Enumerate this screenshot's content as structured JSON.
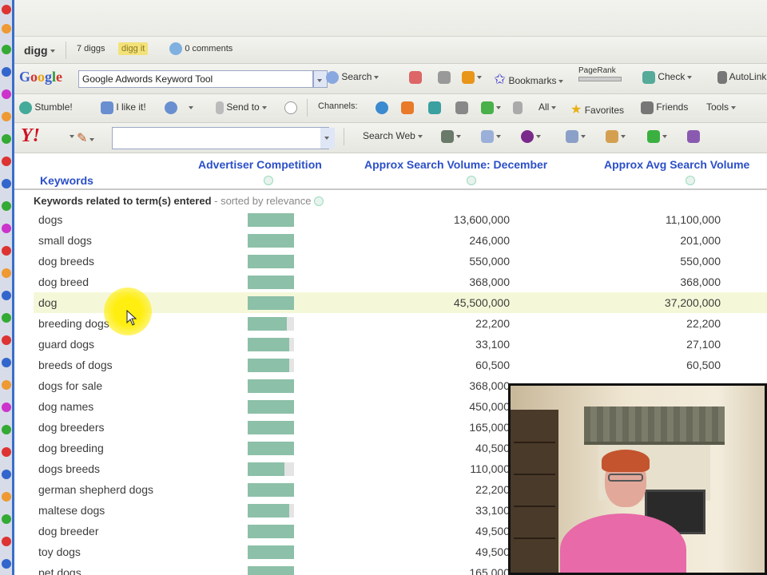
{
  "digg_toolbar": {
    "brand": "digg",
    "diggs": "7 diggs",
    "digg_button": "digg it",
    "comments": "0 comments"
  },
  "google_toolbar": {
    "logo": "Google",
    "search_value": "Google Adwords Keyword Tool",
    "search_label": "Search",
    "bookmarks_label": "Bookmarks",
    "pagerank_label": "PageRank",
    "check_label": "Check",
    "autolink_label": "AutoLink"
  },
  "stumble_toolbar": {
    "stumble_label": "Stumble!",
    "like_label": "I like it!",
    "sendto_label": "Send to",
    "channels_label": "Channels:",
    "all_label": "All",
    "favorites_label": "Favorites",
    "friends_label": "Friends",
    "tools_label": "Tools"
  },
  "yahoo_toolbar": {
    "logo": "Y!",
    "search_value": "",
    "search_web_label": "Search Web"
  },
  "table": {
    "col_keywords": "Keywords",
    "col_competition": "Advertiser Competition",
    "col_volume_december": "Approx Search Volume: December",
    "col_avg_volume": "Approx Avg Search Volume",
    "section_title": "Keywords related to term(s) entered",
    "section_sort": " - sorted by relevance",
    "rows": [
      {
        "keyword": "dogs",
        "competition": 1.0,
        "volume_december": "13,600,000",
        "avg_volume": "11,100,000"
      },
      {
        "keyword": "small dogs",
        "competition": 1.0,
        "volume_december": "246,000",
        "avg_volume": "201,000"
      },
      {
        "keyword": "dog breeds",
        "competition": 1.0,
        "volume_december": "550,000",
        "avg_volume": "550,000"
      },
      {
        "keyword": "dog breed",
        "competition": 1.0,
        "volume_december": "368,000",
        "avg_volume": "368,000"
      },
      {
        "keyword": "dog",
        "competition": 1.0,
        "volume_december": "45,500,000",
        "avg_volume": "37,200,000",
        "highlighted": true
      },
      {
        "keyword": "breeding dogs",
        "competition": 0.85,
        "volume_december": "22,200",
        "avg_volume": "22,200"
      },
      {
        "keyword": "guard dogs",
        "competition": 0.9,
        "volume_december": "33,100",
        "avg_volume": "27,100"
      },
      {
        "keyword": "breeds of dogs",
        "competition": 0.9,
        "volume_december": "60,500",
        "avg_volume": "60,500"
      },
      {
        "keyword": "dogs for sale",
        "competition": 1.0,
        "volume_december": "368,000",
        "avg_volume": ""
      },
      {
        "keyword": "dog names",
        "competition": 1.0,
        "volume_december": "450,000",
        "avg_volume": ""
      },
      {
        "keyword": "dog breeders",
        "competition": 1.0,
        "volume_december": "165,000",
        "avg_volume": ""
      },
      {
        "keyword": "dog breeding",
        "competition": 1.0,
        "volume_december": "40,500",
        "avg_volume": ""
      },
      {
        "keyword": "dogs breeds",
        "competition": 0.8,
        "volume_december": "110,000",
        "avg_volume": ""
      },
      {
        "keyword": "german shepherd dogs",
        "competition": 1.0,
        "volume_december": "22,200",
        "avg_volume": ""
      },
      {
        "keyword": "maltese dogs",
        "competition": 0.9,
        "volume_december": "33,100",
        "avg_volume": ""
      },
      {
        "keyword": "dog breeder",
        "competition": 1.0,
        "volume_december": "49,500",
        "avg_volume": ""
      },
      {
        "keyword": "toy dogs",
        "competition": 1.0,
        "volume_december": "49,500",
        "avg_volume": ""
      },
      {
        "keyword": "pet dogs",
        "competition": 1.0,
        "volume_december": "165,000",
        "avg_volume": ""
      }
    ]
  },
  "colors": {
    "header_link": "#2b4fc8",
    "competition_bar": "#8cc0a8",
    "highlight_row": "#f5f8d8",
    "cursor_highlight": "#ffee10",
    "taskbar_edge": "#3a6fc8"
  }
}
